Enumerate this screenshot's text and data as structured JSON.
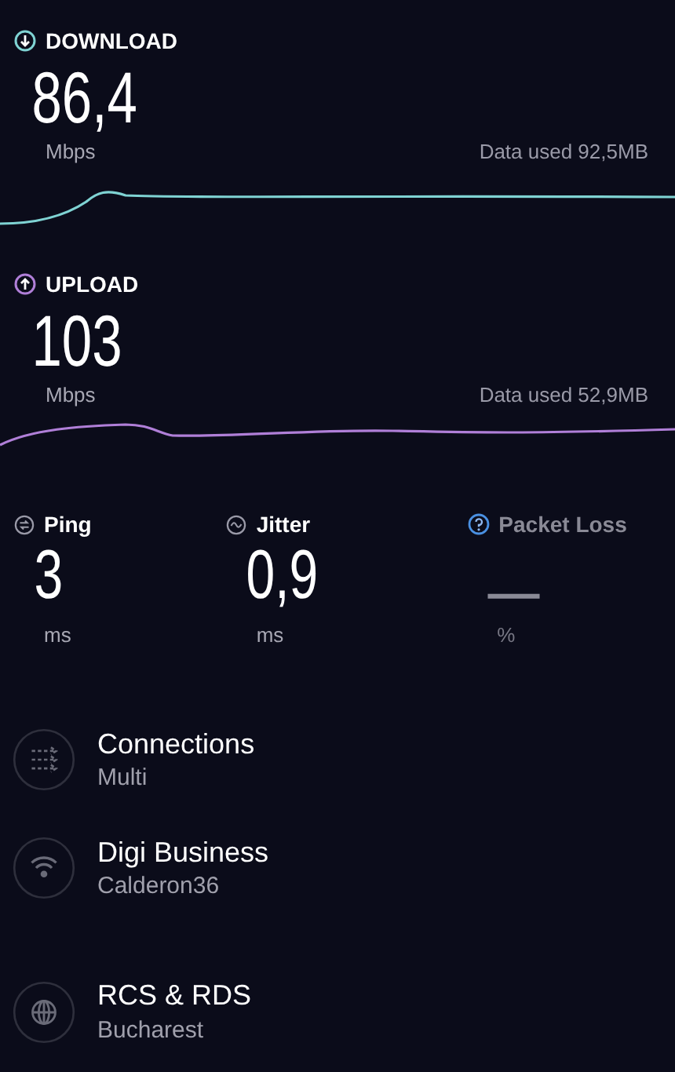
{
  "speeds": [
    {
      "kind": "download",
      "label": "DOWNLOAD",
      "color": "#7fd3d3",
      "value": "86,4",
      "unit": "Mbps",
      "data_used": "Data used 92,5MB"
    },
    {
      "kind": "upload",
      "label": "UPLOAD",
      "color": "#b07fd8",
      "value": "103",
      "unit": "Mbps",
      "data_used": "Data used 52,9MB"
    }
  ],
  "metrics": [
    {
      "kind": "ping",
      "label": "Ping",
      "value": "3",
      "unit": "ms",
      "disabled": false
    },
    {
      "kind": "jitter",
      "label": "Jitter",
      "value": "0,9",
      "unit": "ms",
      "disabled": false
    },
    {
      "kind": "packet_loss",
      "label": "Packet Loss",
      "value": "—",
      "unit": "%",
      "disabled": true
    }
  ],
  "details": [
    {
      "kind": "connections",
      "title": "Connections",
      "subtitle": "Multi"
    },
    {
      "kind": "wifi",
      "title": "Digi Business",
      "subtitle": "Calderon36"
    },
    {
      "kind": "globe",
      "title": "RCS & RDS",
      "subtitle": "Bucharest"
    }
  ]
}
